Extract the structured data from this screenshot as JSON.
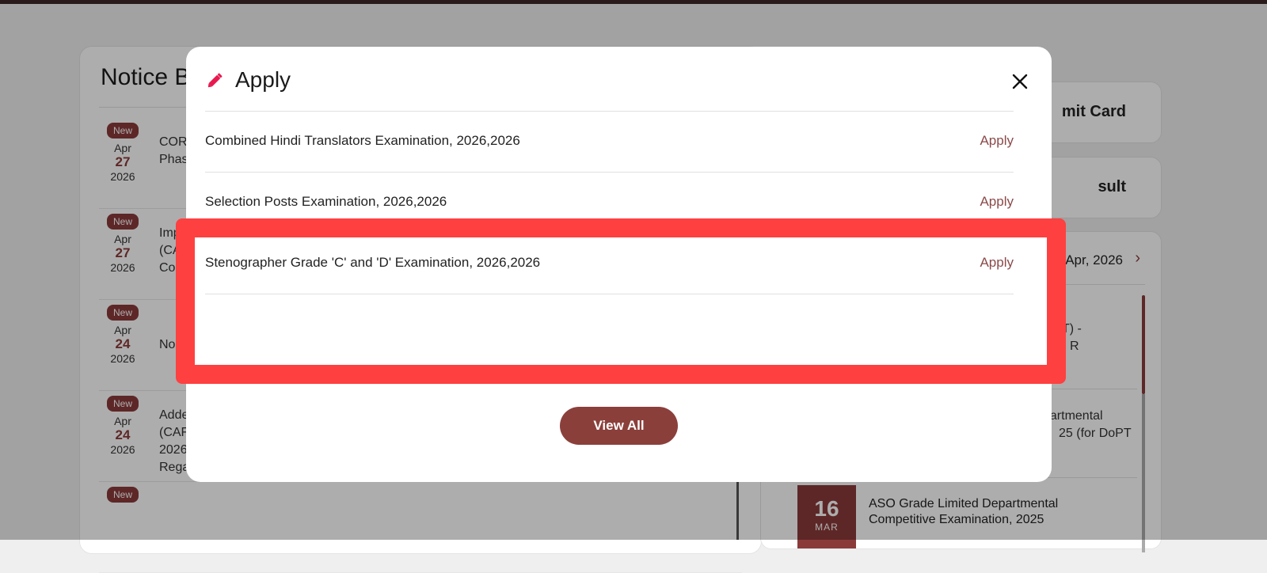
{
  "background": {
    "notice_board": {
      "title": "Notice Board",
      "items": [
        {
          "badge": "New",
          "month": "Apr",
          "day": "27",
          "year": "2026",
          "text": "COR Phas"
        },
        {
          "badge": "New",
          "month": "Apr",
          "day": "27",
          "year": "2026",
          "text": "Imp (CA Cor"
        },
        {
          "badge": "New",
          "month": "Apr",
          "day": "24",
          "year": "2026",
          "text": "No"
        },
        {
          "badge": "New",
          "month": "Apr",
          "day": "24",
          "year": "2026",
          "text": "Adde (CAF 2026 Rega"
        },
        {
          "badge": "New",
          "month": "",
          "day": "",
          "year": "",
          "text": ""
        }
      ]
    },
    "side_links": [
      {
        "label": "mit Card"
      },
      {
        "label": "sult"
      }
    ],
    "calendar": {
      "month_label": "Apr, 2026",
      "next_icon": "chevron-right-icon",
      "fragments": [
        "T) -",
        "R",
        "partmental",
        "25 (for DoPT"
      ],
      "event": {
        "day": "16",
        "month": "MAR",
        "text": "ASO Grade Limited Departmental Competitive Examination, 2025"
      }
    }
  },
  "modal": {
    "title": "Apply",
    "title_icon": "pencil-icon",
    "close_icon": "close-icon",
    "rows": [
      {
        "label": "Combined Hindi Translators Examination, 2026,2026",
        "action": "Apply"
      },
      {
        "label": "Selection Posts Examination, 2026,2026",
        "action": "Apply"
      },
      {
        "label": "Stenographer Grade 'C' and 'D' Examination, 2026,2026",
        "action": "Apply"
      }
    ],
    "view_all_label": "View All"
  },
  "colors": {
    "accent": "#8b3f3b",
    "highlight": "#ff4040",
    "pencil": "#e8194f"
  }
}
